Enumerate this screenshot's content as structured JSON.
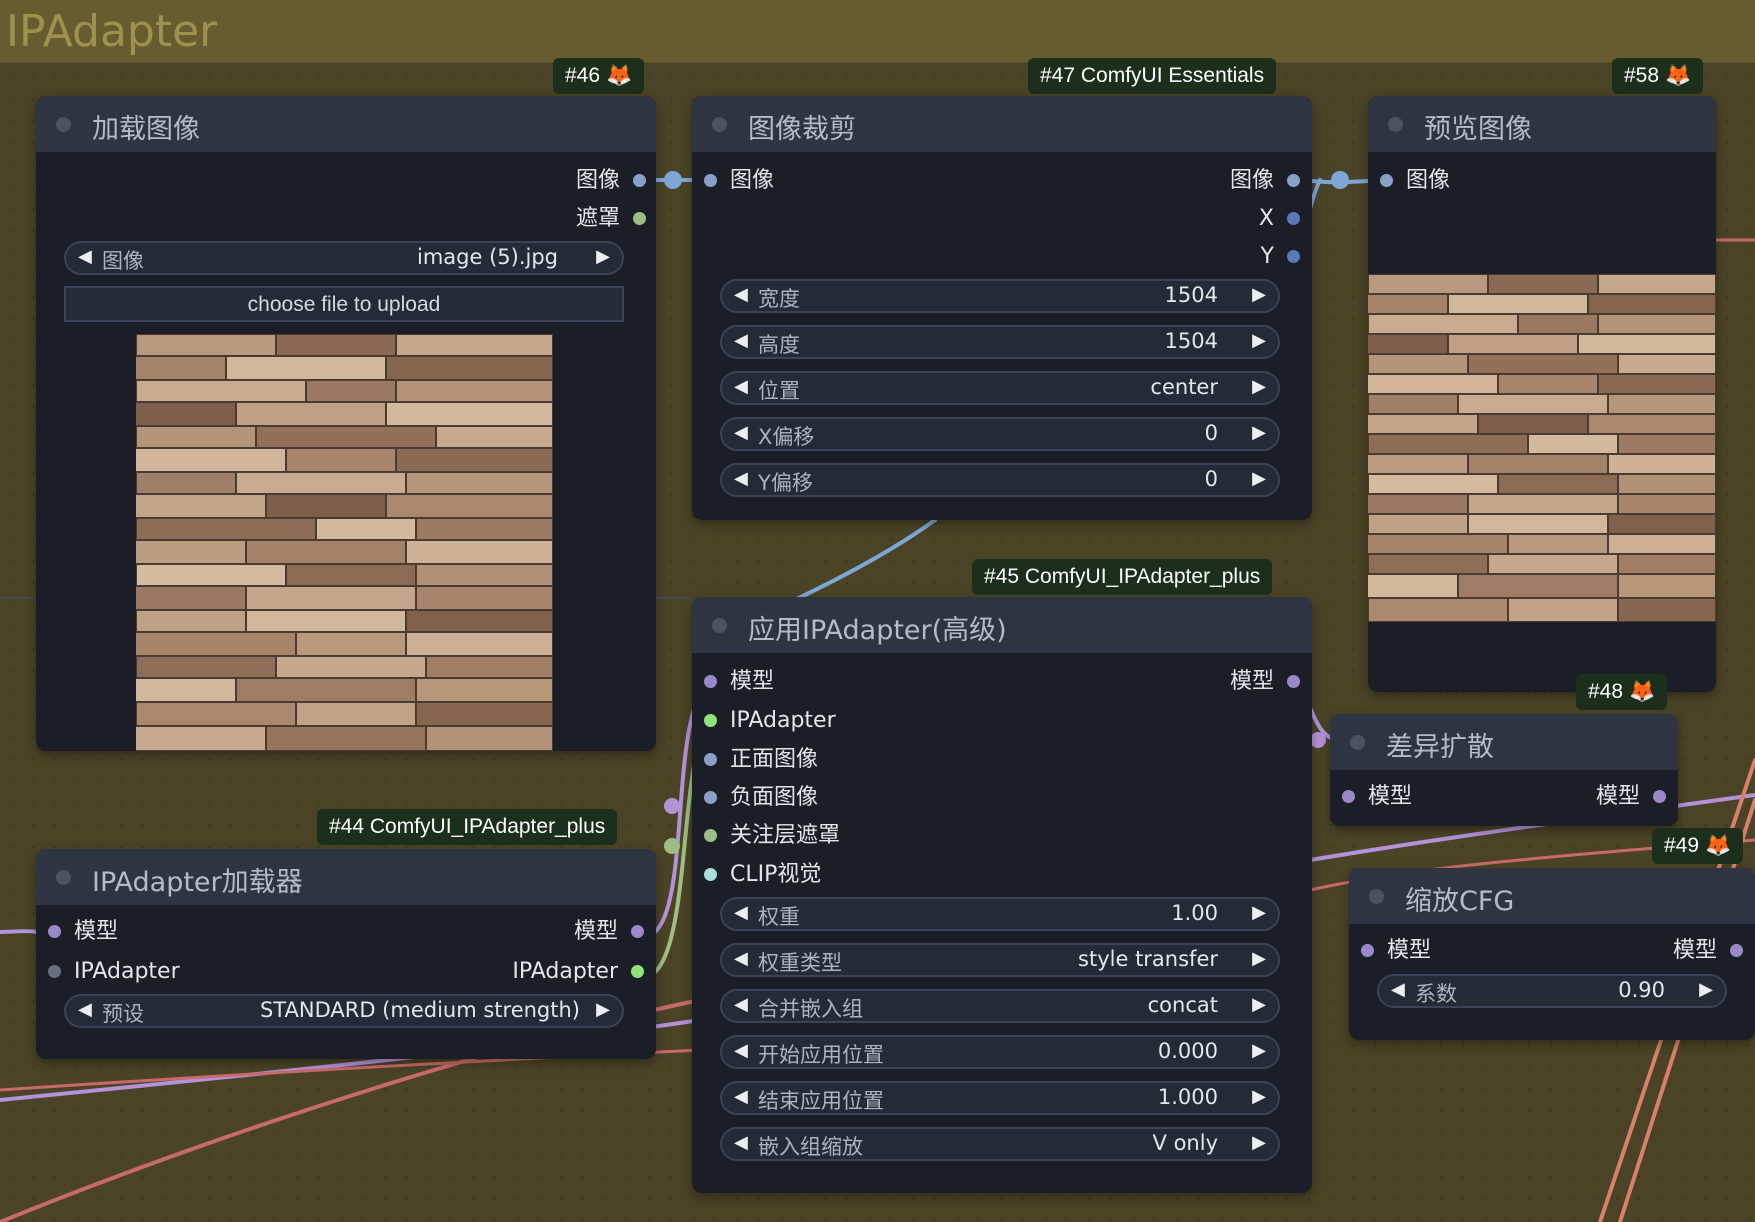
{
  "group": {
    "title": "IPAdapter"
  },
  "colors": {
    "model": "#9b88c8",
    "image": "#8aa0c4",
    "mask": "#9fbe85",
    "ipadapter": "#8de57a",
    "clip_vision": "#a8dde0",
    "int": "#5b77b8",
    "wire_model": "#b392d8",
    "wire_image": "#7ea6d6",
    "wire_red": "#c96a6a"
  },
  "nodes": {
    "load_image": {
      "badge": "#46",
      "title": "加载图像",
      "outputs": [
        "图像",
        "遮罩"
      ],
      "widget": {
        "label": "图像",
        "value": "image (5).jpg"
      },
      "upload_label": "choose file to upload"
    },
    "image_crop": {
      "badge": "#47 ComfyUI Essentials",
      "title": "图像裁剪",
      "input": "图像",
      "outputs": [
        "图像",
        "X",
        "Y"
      ],
      "widgets": [
        {
          "label": "宽度",
          "value": "1504"
        },
        {
          "label": "高度",
          "value": "1504"
        },
        {
          "label": "位置",
          "value": "center"
        },
        {
          "label": "X偏移",
          "value": "0"
        },
        {
          "label": "Y偏移",
          "value": "0"
        }
      ]
    },
    "preview_image": {
      "badge": "#58",
      "title": "预览图像",
      "input": "图像"
    },
    "ipadapter_advanced": {
      "badge": "#45 ComfyUI_IPAdapter_plus",
      "title": "应用IPAdapter(高级)",
      "inputs": [
        "模型",
        "IPAdapter",
        "正面图像",
        "负面图像",
        "关注层遮罩",
        "CLIP视觉"
      ],
      "output": "模型",
      "widgets": [
        {
          "label": "权重",
          "value": "1.00"
        },
        {
          "label": "权重类型",
          "value": "style transfer"
        },
        {
          "label": "合并嵌入组",
          "value": "concat"
        },
        {
          "label": "开始应用位置",
          "value": "0.000"
        },
        {
          "label": "结束应用位置",
          "value": "1.000"
        },
        {
          "label": "嵌入组缩放",
          "value": "V only"
        }
      ]
    },
    "ipadapter_loader": {
      "badge": "#44 ComfyUI_IPAdapter_plus",
      "title": "IPAdapter加载器",
      "inputs": [
        "模型",
        "IPAdapter"
      ],
      "outputs": [
        "模型",
        "IPAdapter"
      ],
      "widget": {
        "label": "预设",
        "value": "STANDARD (medium strength)"
      }
    },
    "diff_diffusion": {
      "badge": "#48",
      "title": "差异扩散",
      "input": "模型",
      "output": "模型"
    },
    "rescale_cfg": {
      "badge": "#49",
      "title": "缩放CFG",
      "input": "模型",
      "output": "模型",
      "widget": {
        "label": "系数",
        "value": "0.90"
      }
    }
  }
}
